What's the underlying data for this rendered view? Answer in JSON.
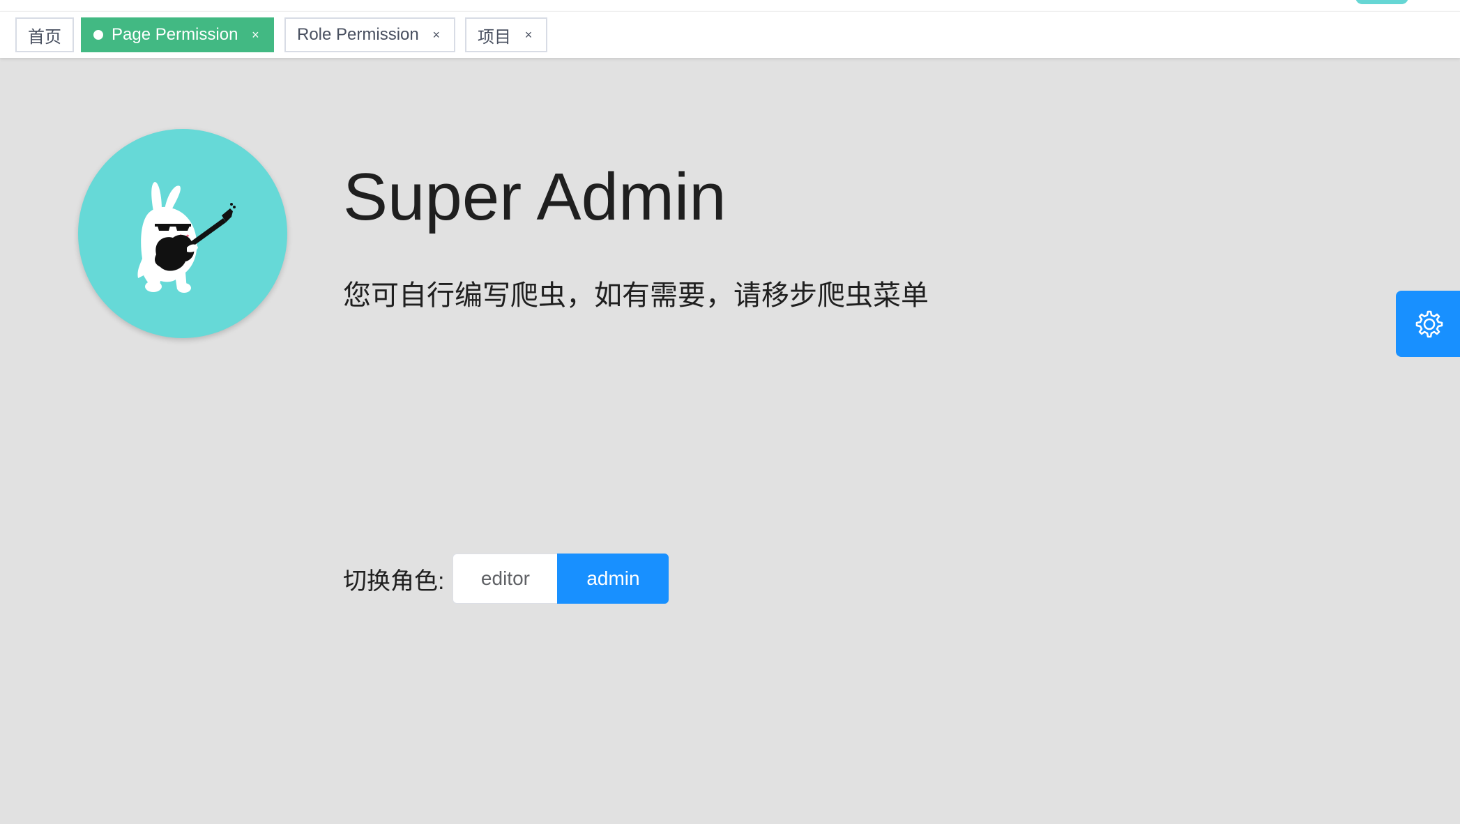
{
  "tags": [
    {
      "label": "首页",
      "closable": false,
      "active": false
    },
    {
      "label": "Page Permission",
      "closable": true,
      "active": true
    },
    {
      "label": "Role Permission",
      "closable": true,
      "active": false
    },
    {
      "label": "项目",
      "closable": true,
      "active": false
    }
  ],
  "tag_close_glyph": "×",
  "profile": {
    "title": "Super Admin",
    "description": "您可自行编写爬虫，如有需要，请移步爬虫菜单"
  },
  "role_switch": {
    "label": "切换角色:",
    "options": [
      "editor",
      "admin"
    ],
    "selected": "admin"
  },
  "colors": {
    "active_tag": "#42b983",
    "primary": "#1890ff",
    "avatar_bg": "#66d9d7",
    "page_bg": "#e1e1e1"
  },
  "icons": {
    "avatar": "rabbit-guitar-icon",
    "settings": "gear-icon",
    "tag_dot": "dot-icon",
    "tag_close": "close-icon"
  }
}
